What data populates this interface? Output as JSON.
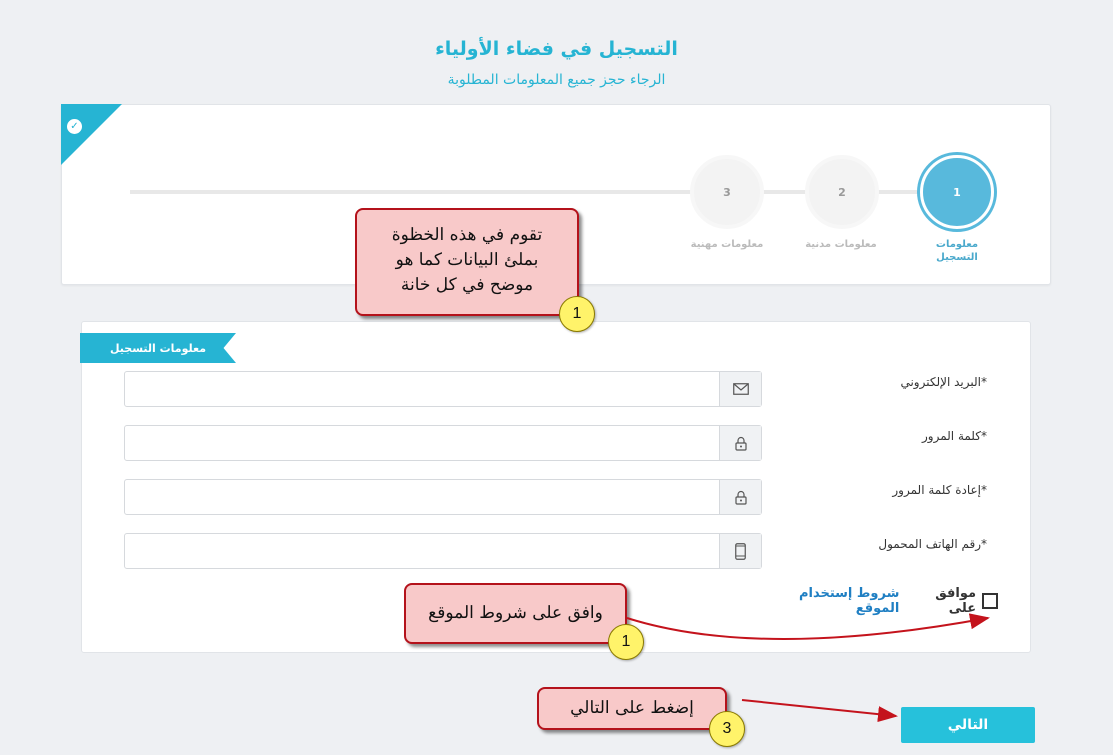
{
  "page": {
    "title": "التسجيل في فضاء الأولياء",
    "subtitle": "الرجاء حجز جميع المعلومات المطلوبة"
  },
  "stepper": {
    "steps": [
      {
        "number": "1",
        "label": "معلومات التسجيل",
        "active": true
      },
      {
        "number": "2",
        "label": "معلومات مدنية",
        "active": false
      },
      {
        "number": "3",
        "label": "معلومات مهنية",
        "active": false
      }
    ]
  },
  "form": {
    "section_title": "معلومات التسجيل",
    "fields": [
      {
        "label": "البريد الإلكتروني*",
        "value": "",
        "icon": "envelope-icon"
      },
      {
        "label": "كلمة المرور*",
        "value": "",
        "icon": "lock-icon"
      },
      {
        "label": "إعادة كلمة المرور*",
        "value": "",
        "icon": "lock-icon"
      },
      {
        "label": "رقم الهاتف المحمول*",
        "value": "",
        "icon": "mobile-phone-icon"
      }
    ],
    "terms": {
      "prefix": "موافق على",
      "link": "شروط إستخدام الموقع",
      "checked": false
    },
    "next_label": "التالي"
  },
  "annotations": {
    "step_note": {
      "text_line1": "تقوم في هذه الخظوة",
      "text_line2": "بملئ البيانات كما هو",
      "text_line3": "موضح في كل خانة",
      "badge": "1"
    },
    "terms_note": {
      "text": "وافق على شروط الموقع",
      "badge": "1"
    },
    "next_note": {
      "text": "إضغط على التالي",
      "badge": "3"
    }
  },
  "colors": {
    "accent": "#26b4d3",
    "callout_fill": "#f8c9c9",
    "callout_border": "#b4121b",
    "badge_fill": "#fff36a",
    "link": "#1f7fc3"
  }
}
